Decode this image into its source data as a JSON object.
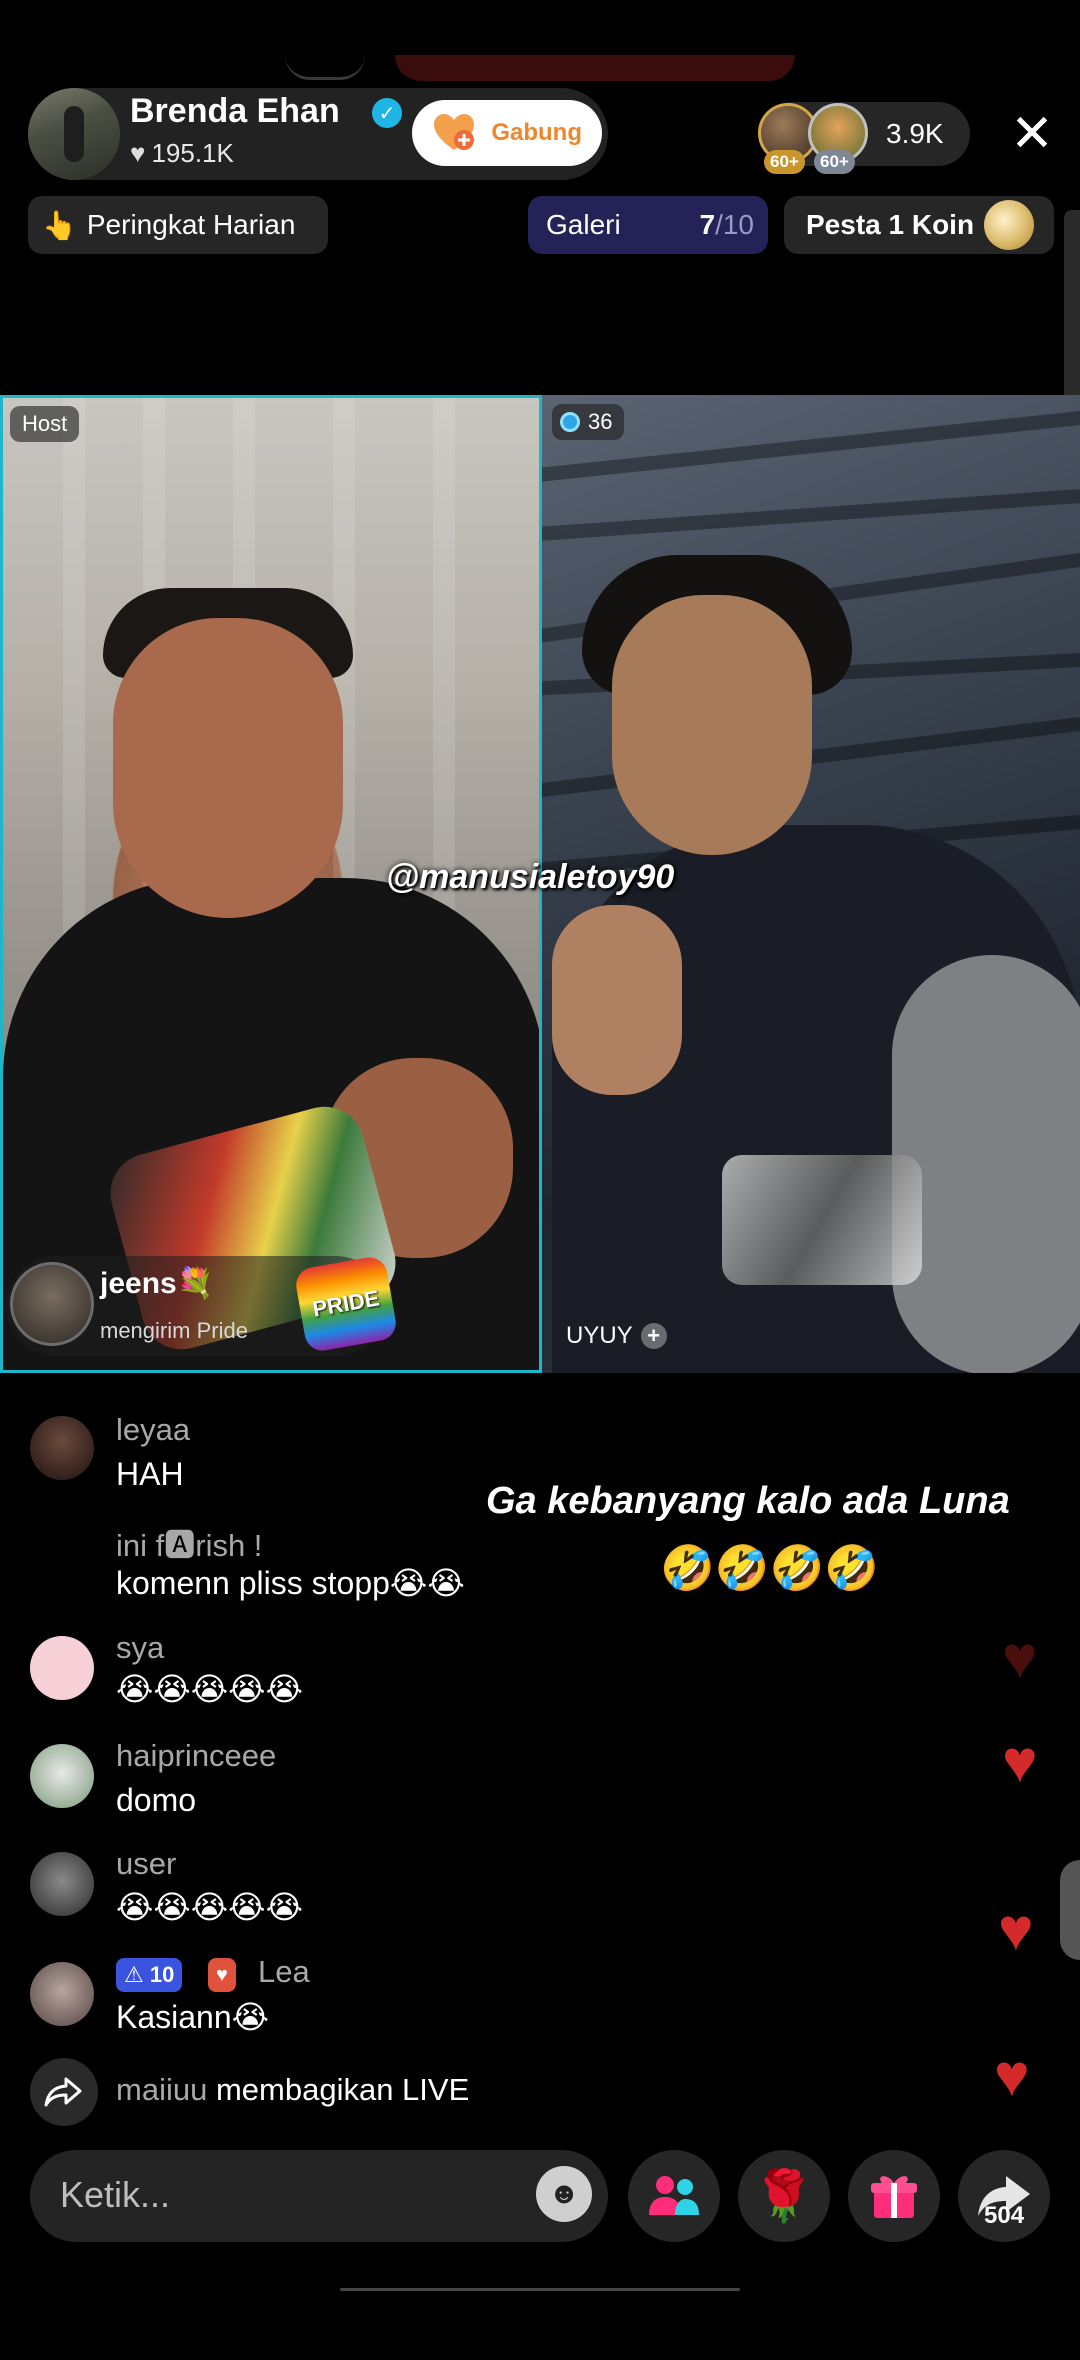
{
  "header": {
    "host_name": "Brenda Ehan",
    "likes": "195.1K",
    "join_label": "Gabung",
    "viewer_levels": [
      "60+",
      "60+"
    ],
    "viewer_count": "3.9K"
  },
  "pills": {
    "ranking_label": "Peringkat Harian",
    "gallery_label": "Galeri",
    "gallery_count": "7",
    "gallery_total": "/10",
    "party_label": "Pesta 1 Koin"
  },
  "video": {
    "host_badge": "Host",
    "guest_score": "36",
    "watermark": "@manusialetoy90",
    "guest_name": "UYUY"
  },
  "gift_notification": {
    "user": "jeens💐",
    "action": "mengirim Pride",
    "gift_label": "PRIDE"
  },
  "comments": [
    {
      "user": "leyaa",
      "text": "HAH"
    },
    {
      "user": "ini f🅰rish !",
      "text": "komenn pliss stopp😭😭"
    },
    {
      "user": "sya",
      "text": "😭😭😭😭😭"
    },
    {
      "user": "haiprinceee",
      "text": "domo"
    },
    {
      "user": "user",
      "text": "😭😭😭😭😭"
    },
    {
      "user": "Lea",
      "text": "Kasiann😭",
      "level": "10"
    }
  ],
  "overlay_caption": {
    "line1": "Ga kebanyang kalo ada Luna",
    "line2": "🤣🤣🤣🤣"
  },
  "share_event": {
    "user": "maiiuu",
    "text": "membagikan LIVE"
  },
  "bottom_bar": {
    "input_placeholder": "Ketik...",
    "share_count": "504"
  },
  "colors": {
    "accent_cyan": "#1fb6c9",
    "join_orange": "#f0862c",
    "heart_red": "#d42a2a"
  }
}
